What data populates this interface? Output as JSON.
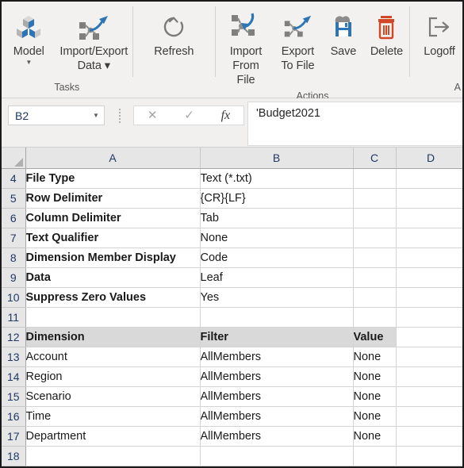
{
  "ribbon": {
    "groups": [
      {
        "label": "Tasks",
        "buttons": [
          {
            "name": "model",
            "label": "Model",
            "icon": "cubes-icon",
            "caret": "▼"
          },
          {
            "name": "import-export-data",
            "label": "Import/Export\nData ▾",
            "icon": "export-nodes-icon",
            "caret": ""
          }
        ]
      },
      {
        "label": "",
        "buttons": [
          {
            "name": "refresh",
            "label": "Refresh",
            "icon": "refresh-icon",
            "caret": ""
          }
        ]
      },
      {
        "label": "Actions",
        "buttons": [
          {
            "name": "import-from-file",
            "label": "Import\nFrom File",
            "icon": "import-file-icon",
            "caret": ""
          },
          {
            "name": "export-to-file",
            "label": "Export\nTo File",
            "icon": "export-file-icon",
            "caret": ""
          },
          {
            "name": "save",
            "label": "Save",
            "icon": "save-icon",
            "caret": ""
          },
          {
            "name": "delete",
            "label": "Delete",
            "icon": "trash-icon",
            "caret": ""
          }
        ]
      },
      {
        "label": "A",
        "buttons": [
          {
            "name": "logoff",
            "label": "Logoff",
            "icon": "logoff-icon",
            "caret": ""
          }
        ]
      }
    ]
  },
  "formula_bar": {
    "name_box_value": "B2",
    "cancel_icon": "✕",
    "accept_icon": "✓",
    "function_icon": "fx",
    "formula_value": "'Budget2021"
  },
  "sheet": {
    "columns": [
      "A",
      "B",
      "C",
      "D"
    ],
    "rows": [
      {
        "num": "4",
        "cells": [
          "File Type",
          "Text (*.txt)",
          "",
          ""
        ],
        "bold_first": true,
        "shaded": false
      },
      {
        "num": "5",
        "cells": [
          "Row Delimiter",
          "{CR}{LF}",
          "",
          ""
        ],
        "bold_first": true,
        "shaded": false
      },
      {
        "num": "6",
        "cells": [
          "Column Delimiter",
          "Tab",
          "",
          ""
        ],
        "bold_first": true,
        "shaded": false
      },
      {
        "num": "7",
        "cells": [
          "Text Qualifier",
          "None",
          "",
          ""
        ],
        "bold_first": true,
        "shaded": false
      },
      {
        "num": "8",
        "cells": [
          "Dimension Member Display",
          "Code",
          "",
          ""
        ],
        "bold_first": true,
        "shaded": false
      },
      {
        "num": "9",
        "cells": [
          "Data",
          "Leaf",
          "",
          ""
        ],
        "bold_first": true,
        "shaded": false
      },
      {
        "num": "10",
        "cells": [
          "Suppress Zero Values",
          "Yes",
          "",
          ""
        ],
        "bold_first": true,
        "shaded": false
      },
      {
        "num": "11",
        "cells": [
          "",
          "",
          "",
          ""
        ],
        "bold_first": false,
        "shaded": false
      },
      {
        "num": "12",
        "cells": [
          "Dimension",
          "Filter",
          "Value",
          ""
        ],
        "bold_first": true,
        "shaded": true
      },
      {
        "num": "13",
        "cells": [
          "Account",
          "AllMembers",
          "None",
          ""
        ],
        "bold_first": false,
        "shaded": false
      },
      {
        "num": "14",
        "cells": [
          "Region",
          "AllMembers",
          "None",
          ""
        ],
        "bold_first": false,
        "shaded": false
      },
      {
        "num": "15",
        "cells": [
          "Scenario",
          "AllMembers",
          "None",
          ""
        ],
        "bold_first": false,
        "shaded": false
      },
      {
        "num": "16",
        "cells": [
          "Time",
          "AllMembers",
          "None",
          ""
        ],
        "bold_first": false,
        "shaded": false
      },
      {
        "num": "17",
        "cells": [
          "Department",
          "AllMembers",
          "None",
          ""
        ],
        "bold_first": false,
        "shaded": false
      },
      {
        "num": "18",
        "cells": [
          "",
          "",
          "",
          ""
        ],
        "bold_first": false,
        "shaded": false
      }
    ]
  },
  "colors": {
    "accent_blue": "#2e75b6",
    "delete_red": "#d24726",
    "header_gray": "#e6e6e6",
    "shade_gray": "#d9d9d9",
    "rowhead_text": "#1f3864"
  }
}
